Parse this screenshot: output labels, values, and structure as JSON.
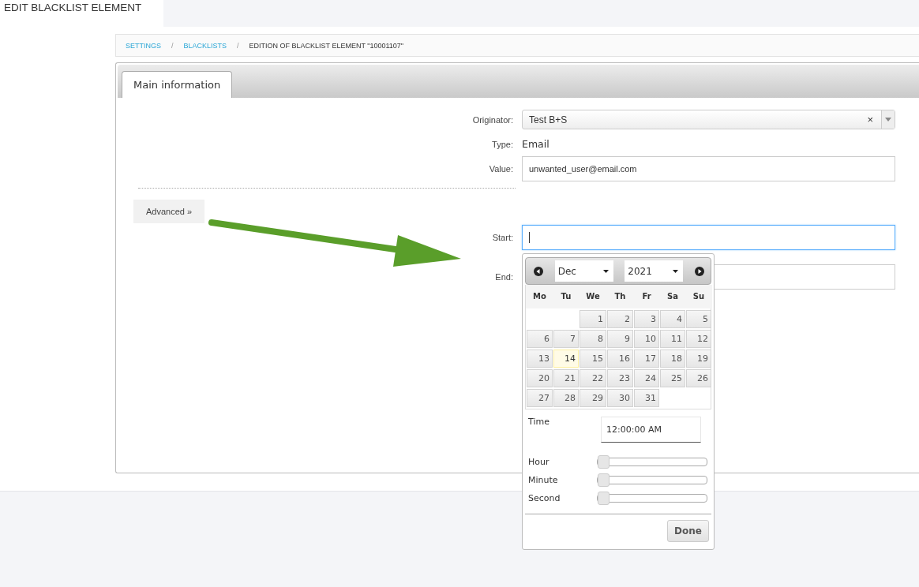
{
  "page_title": "EDIT BLACKLIST ELEMENT",
  "breadcrumb": [
    {
      "label": "SETTINGS",
      "kind": "link"
    },
    {
      "label": "/",
      "kind": "sep"
    },
    {
      "label": "BLACKLISTS",
      "kind": "link"
    },
    {
      "label": "/",
      "kind": "sep"
    },
    {
      "label": "EDITION OF BLACKLIST ELEMENT \"10001107\"",
      "kind": "current"
    }
  ],
  "tabs": [
    {
      "label": "Main information",
      "selected": true
    }
  ],
  "fields": [
    {
      "label": "Originator:",
      "kind": "select",
      "value": "Test B+S",
      "clear": "×"
    },
    {
      "label": "Type:",
      "kind": "text",
      "value": "Email"
    },
    {
      "label": "Value:",
      "kind": "input",
      "value": "unwanted_user@email.com"
    }
  ],
  "advanced_button": "Advanced »",
  "date_fields": [
    {
      "label": "Start:",
      "focused": true
    },
    {
      "label": "End:",
      "focused": false
    }
  ],
  "datepicker": {
    "month": "Dec",
    "year": "2021",
    "weekdays": [
      "Mo",
      "Tu",
      "We",
      "Th",
      "Fr",
      "Sa",
      "Su"
    ],
    "weeks": [
      [
        {
          "kind": "blank"
        },
        {
          "kind": "blank"
        },
        {
          "kind": "day",
          "day": "1",
          "today": false
        },
        {
          "kind": "day",
          "day": "2",
          "today": false
        },
        {
          "kind": "day",
          "day": "3",
          "today": false
        },
        {
          "kind": "day",
          "day": "4",
          "today": false
        },
        {
          "kind": "day",
          "day": "5",
          "today": false
        }
      ],
      [
        {
          "kind": "day",
          "day": "6",
          "today": false
        },
        {
          "kind": "day",
          "day": "7",
          "today": false
        },
        {
          "kind": "day",
          "day": "8",
          "today": false
        },
        {
          "kind": "day",
          "day": "9",
          "today": false
        },
        {
          "kind": "day",
          "day": "10",
          "today": false
        },
        {
          "kind": "day",
          "day": "11",
          "today": false
        },
        {
          "kind": "day",
          "day": "12",
          "today": false
        }
      ],
      [
        {
          "kind": "day",
          "day": "13",
          "today": false
        },
        {
          "kind": "day",
          "day": "14",
          "today": true
        },
        {
          "kind": "day",
          "day": "15",
          "today": false
        },
        {
          "kind": "day",
          "day": "16",
          "today": false
        },
        {
          "kind": "day",
          "day": "17",
          "today": false
        },
        {
          "kind": "day",
          "day": "18",
          "today": false
        },
        {
          "kind": "day",
          "day": "19",
          "today": false
        }
      ],
      [
        {
          "kind": "day",
          "day": "20",
          "today": false
        },
        {
          "kind": "day",
          "day": "21",
          "today": false
        },
        {
          "kind": "day",
          "day": "22",
          "today": false
        },
        {
          "kind": "day",
          "day": "23",
          "today": false
        },
        {
          "kind": "day",
          "day": "24",
          "today": false
        },
        {
          "kind": "day",
          "day": "25",
          "today": false
        },
        {
          "kind": "day",
          "day": "26",
          "today": false
        }
      ],
      [
        {
          "kind": "day",
          "day": "27",
          "today": false
        },
        {
          "kind": "day",
          "day": "28",
          "today": false
        },
        {
          "kind": "day",
          "day": "29",
          "today": false
        },
        {
          "kind": "day",
          "day": "30",
          "today": false
        },
        {
          "kind": "day",
          "day": "31",
          "today": false
        },
        {
          "kind": "blank"
        },
        {
          "kind": "blank"
        }
      ]
    ],
    "time_label": "Time",
    "time_value": "12:00:00 AM",
    "sliders": [
      {
        "label": "Hour",
        "level": 0
      },
      {
        "label": "Minute",
        "level": 0
      },
      {
        "label": "Second",
        "level": 0
      }
    ],
    "done": "Done"
  }
}
